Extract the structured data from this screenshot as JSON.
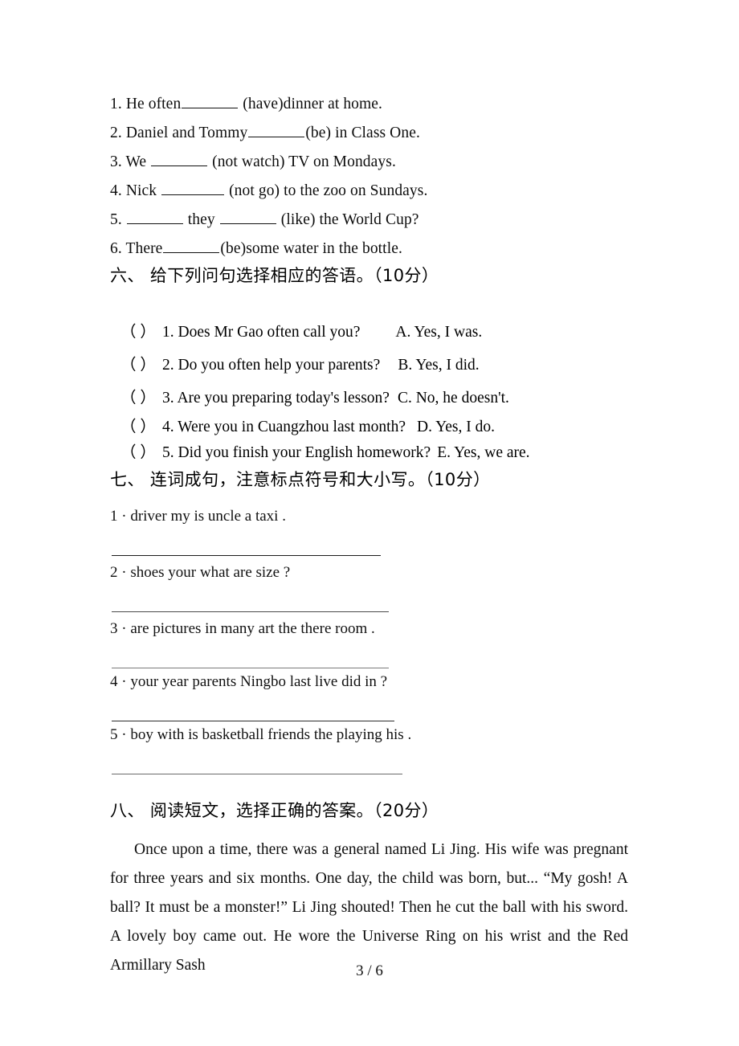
{
  "document": {
    "page_label": "3 / 6"
  },
  "fill_in_section": {
    "items": [
      {
        "number": "1.",
        "before": "He often",
        "blank": "b-md",
        "after": "(have)dinner at home."
      },
      {
        "number": "2.",
        "before": "Daniel and Tommy",
        "blank": "b-md",
        "after": "(be) in Class One."
      },
      {
        "number": "3.",
        "before": "We ",
        "blank": "b-md",
        "after": " (not watch) TV on Mondays."
      },
      {
        "number": "4.",
        "before": "Nick ",
        "blank": "b-lg",
        "after": " (not go) to the zoo on Sundays."
      },
      {
        "number": "5.",
        "before": "",
        "blank": "b-md",
        "after": " (like) the World Cup?",
        "middle": " they "
      },
      {
        "number": "6.",
        "before": "There",
        "blank": "b-md",
        "after": "(be)some water in the bottle."
      }
    ]
  },
  "section_six": {
    "heading": "六、 给下列问句选择相应的答语。（10分）",
    "bracket": "（    ）",
    "rows": [
      {
        "number": "1.",
        "question": "Does Mr Gao often call you?",
        "answer": "A. Yes, I was."
      },
      {
        "number": "2.",
        "question": "Do you often help your parents?",
        "answer": "B. Yes, I did."
      },
      {
        "number": "3.",
        "question": "Are you preparing today's lesson?",
        "answer": "C. No, he doesn't."
      },
      {
        "number": "4.",
        "question": "Were you in Cuangzhou last month?",
        "answer": "D. Yes, I do."
      },
      {
        "number": "5.",
        "question": "Did you finish your English homework?",
        "answer": "E. Yes, we are."
      }
    ]
  },
  "section_seven": {
    "heading": "七、 连词成句，注意标点符号和大小写。（10分）",
    "items": [
      {
        "text": "1 · driver my is uncle a taxi ."
      },
      {
        "text": "2 · shoes your what are size ?"
      },
      {
        "text": "3 · are pictures in many art the there room  ."
      },
      {
        "text": "4 · your year parents Ningbo last live did in ?"
      },
      {
        "text": "5 · boy with is basketball friends the playing his ."
      }
    ]
  },
  "section_eight": {
    "heading": "八、 阅读短文，选择正确的答案。（20分）",
    "passage": "Once upon a time, there was a general named Li Jing. His wife was pregnant for three years and six months. One day, the child was born, but... “My gosh! A ball? It must be a monster!” Li Jing shouted! Then he cut the ball with his sword. A lovely boy came out. He wore the Universe Ring on his wrist and the Red Armillary Sash"
  }
}
